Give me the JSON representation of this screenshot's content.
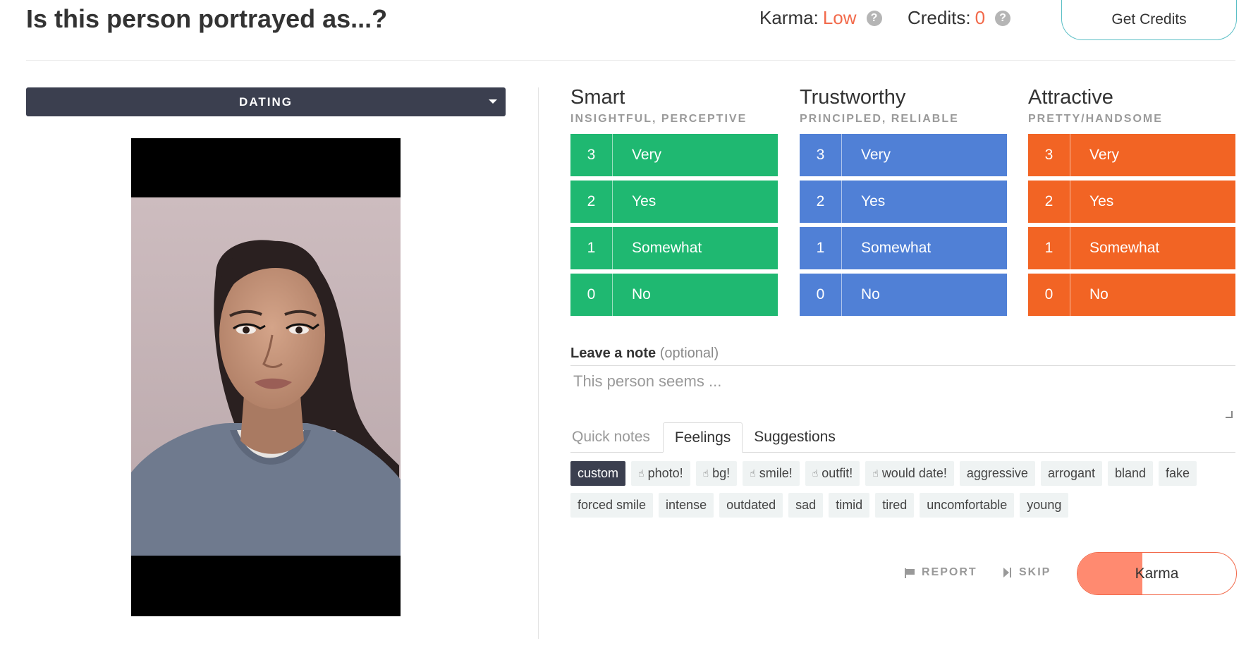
{
  "header": {
    "title": "Is this person portrayed as...?",
    "karma_label": "Karma:",
    "karma_value": "Low",
    "credits_label": "Credits:",
    "credits_value": "0",
    "get_credits": "Get Credits"
  },
  "category": {
    "selected": "DATING"
  },
  "ratings": [
    {
      "title": "Smart",
      "subtitle": "INSIGHTFUL, PERCEPTIVE",
      "color": "#1fb871",
      "options": [
        {
          "num": "3",
          "label": "Very"
        },
        {
          "num": "2",
          "label": "Yes"
        },
        {
          "num": "1",
          "label": "Somewhat"
        },
        {
          "num": "0",
          "label": "No"
        }
      ]
    },
    {
      "title": "Trustworthy",
      "subtitle": "PRINCIPLED, RELIABLE",
      "color": "#5080d6",
      "options": [
        {
          "num": "3",
          "label": "Very"
        },
        {
          "num": "2",
          "label": "Yes"
        },
        {
          "num": "1",
          "label": "Somewhat"
        },
        {
          "num": "0",
          "label": "No"
        }
      ]
    },
    {
      "title": "Attractive",
      "subtitle": "PRETTY/HANDSOME",
      "color": "#f26424",
      "options": [
        {
          "num": "3",
          "label": "Very"
        },
        {
          "num": "2",
          "label": "Yes"
        },
        {
          "num": "1",
          "label": "Somewhat"
        },
        {
          "num": "0",
          "label": "No"
        }
      ]
    }
  ],
  "note": {
    "label": "Leave a note",
    "optional": "(optional)",
    "placeholder": "This person seems ..."
  },
  "tabs": {
    "quick_notes": "Quick notes",
    "feelings": "Feelings",
    "suggestions": "Suggestions"
  },
  "tags": [
    {
      "label": "custom",
      "style": "dark",
      "icon": ""
    },
    {
      "label": "photo!",
      "style": "light",
      "icon": "thumbs-up-icon"
    },
    {
      "label": "bg!",
      "style": "light",
      "icon": "thumbs-up-icon"
    },
    {
      "label": "smile!",
      "style": "light",
      "icon": "thumbs-up-icon"
    },
    {
      "label": "outfit!",
      "style": "light",
      "icon": "thumbs-up-icon"
    },
    {
      "label": "would date!",
      "style": "light",
      "icon": "thumbs-up-icon"
    },
    {
      "label": "aggressive",
      "style": "light",
      "icon": ""
    },
    {
      "label": "arrogant",
      "style": "light",
      "icon": ""
    },
    {
      "label": "bland",
      "style": "light",
      "icon": ""
    },
    {
      "label": "fake",
      "style": "light",
      "icon": ""
    },
    {
      "label": "forced smile",
      "style": "light",
      "icon": ""
    },
    {
      "label": "intense",
      "style": "light",
      "icon": ""
    },
    {
      "label": "outdated",
      "style": "light",
      "icon": ""
    },
    {
      "label": "sad",
      "style": "light",
      "icon": ""
    },
    {
      "label": "timid",
      "style": "light",
      "icon": ""
    },
    {
      "label": "tired",
      "style": "light",
      "icon": ""
    },
    {
      "label": "uncomfortable",
      "style": "light",
      "icon": ""
    },
    {
      "label": "young",
      "style": "light",
      "icon": ""
    }
  ],
  "actions": {
    "report": "REPORT",
    "skip": "SKIP",
    "karma": "Karma",
    "karma_progress": 0.41
  },
  "colors": {
    "accent": "#f26a4b",
    "dark": "#3b3f4f",
    "button_border": "#5bbfc6"
  }
}
